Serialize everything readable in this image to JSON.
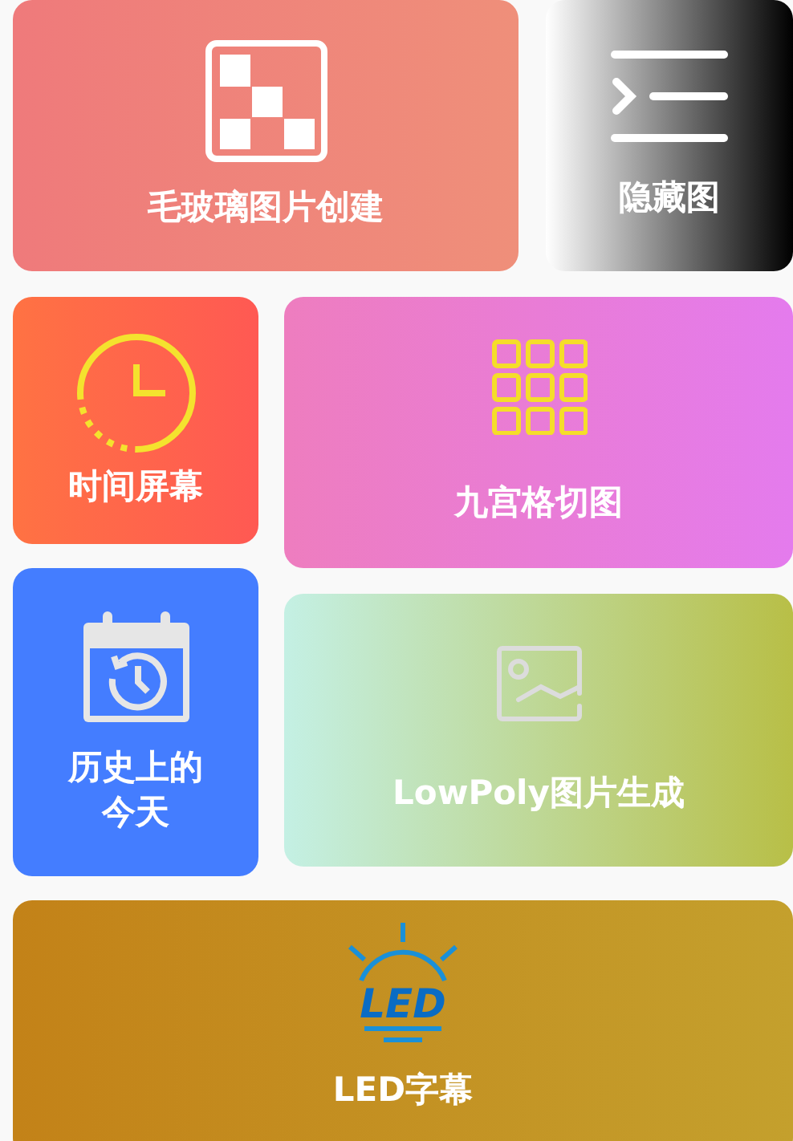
{
  "tiles": [
    {
      "kind": "mosaic",
      "label": "毛玻璃图片创建",
      "color": "#ef7a7b"
    },
    {
      "kind": "hide",
      "label": "隐藏图",
      "color": "#ffffff"
    },
    {
      "kind": "clock",
      "label": "时间屏幕",
      "color": "#ff7243"
    },
    {
      "kind": "grid",
      "label": "九宫格切图",
      "color": "#ee7dbf"
    },
    {
      "kind": "calendar",
      "label": "历史上的今天",
      "color": "#447dff"
    },
    {
      "kind": "image",
      "label": "LowPoly图片生成",
      "color": "#c4f0e4"
    },
    {
      "kind": "led",
      "label": "LED字幕",
      "icon_text": "LED",
      "color": "#c38218"
    }
  ]
}
